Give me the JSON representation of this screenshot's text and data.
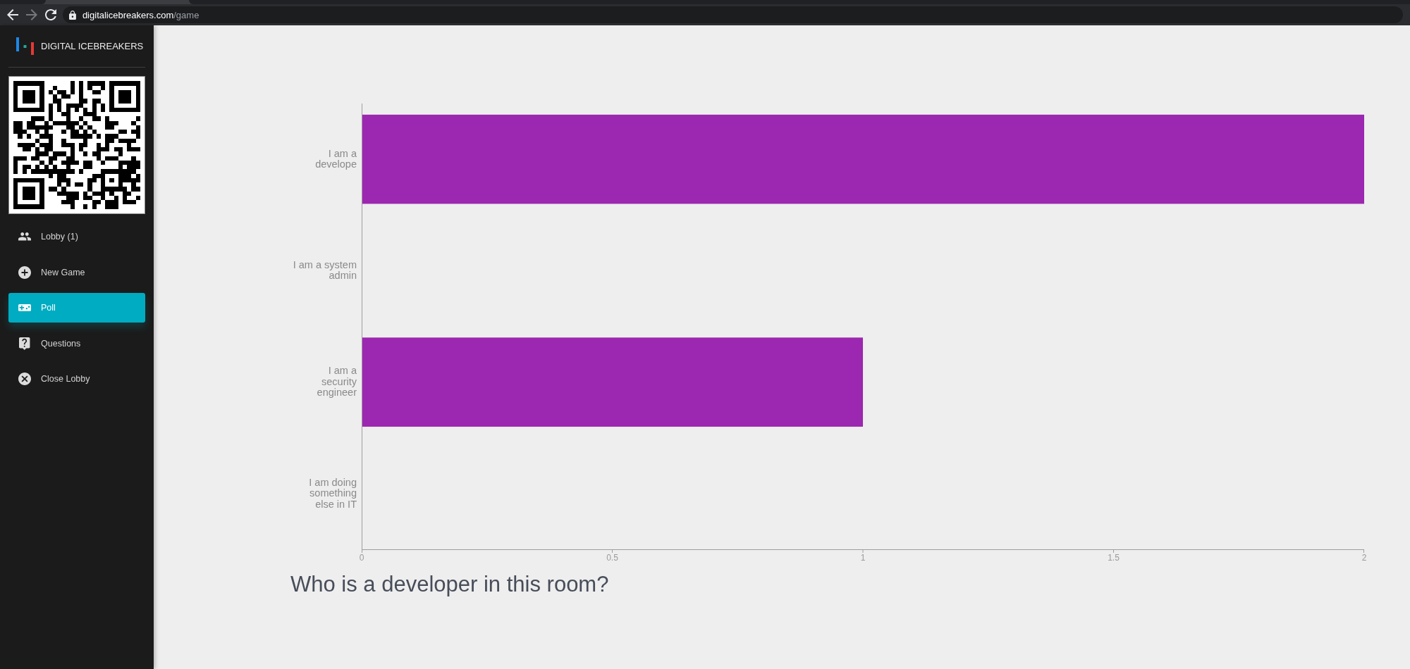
{
  "browser": {
    "nav": [
      {
        "kind": "back",
        "disabled": false
      },
      {
        "kind": "forward",
        "disabled": true
      },
      {
        "kind": "reload",
        "disabled": false
      }
    ],
    "url": "**digitalicebreakers.com**/game"
  },
  "sidebar": {
    "brand": "DIGITAL ICEBREAKERS",
    "menu": [
      {
        "label": "Lobby (1)",
        "kind": "people",
        "selected": false
      },
      {
        "label": "New Game",
        "kind": "add",
        "selected": false
      },
      {
        "label": "Poll",
        "kind": "gamepad",
        "selected": true
      },
      {
        "label": "Questions",
        "kind": "help",
        "selected": false
      },
      {
        "label": "Close Lobby",
        "kind": "cancel",
        "selected": false
      }
    ]
  },
  "poll": {
    "chart_data": {
      "type": "bar",
      "orientation": "horizontal",
      "categories": [
        "I am a\ndevelope",
        "I am a system\nadmin",
        "I am a\nsecurity\nengineer",
        "I am doing\nsomething\nelse in IT"
      ],
      "series": [
        {
          "color": "#9c27b0",
          "values": [
            2,
            0,
            1,
            0
          ]
        }
      ],
      "xlim": [
        0,
        2
      ],
      "xticks": [
        0,
        0.5,
        1,
        1.5,
        2
      ]
    },
    "question": "Who is a developer in this room?"
  }
}
